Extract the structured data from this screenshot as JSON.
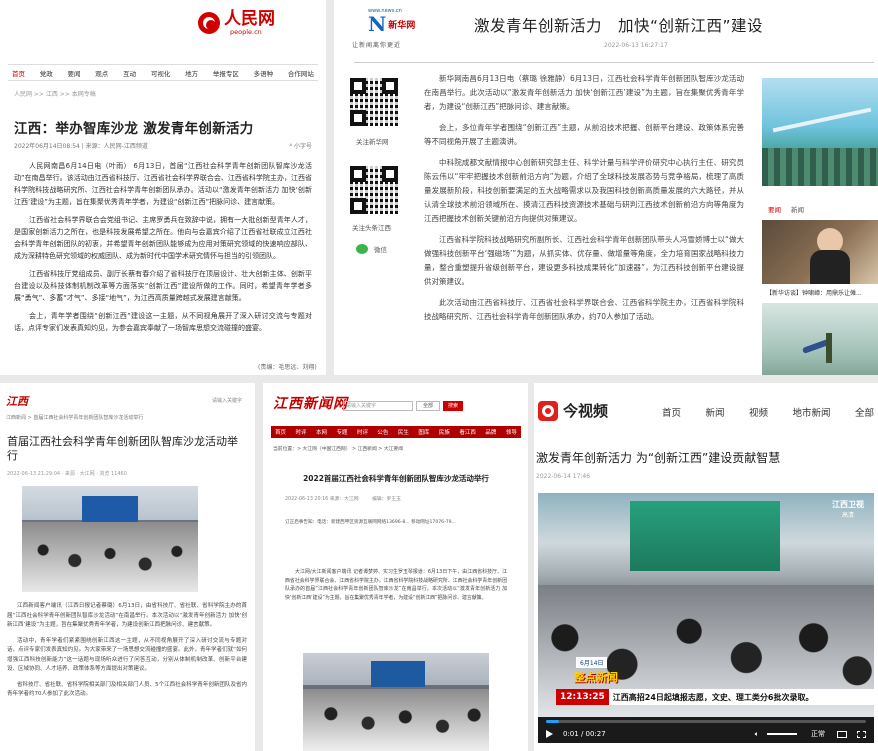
{
  "p1": {
    "logo": "人民网",
    "logo_sub": "people.cn",
    "nav": [
      "首页",
      "党政",
      "要闻",
      "观点",
      "互动",
      "可视化",
      "地方",
      "举报专区",
      "多语种",
      "合作网站"
    ],
    "breadcrumb": "人民网 >> 江西 >> 本网专稿",
    "title": "江西：举办智库沙龙 激发青年创新活力",
    "meta": "2022年06月14日08:54 | 来源：人民网-江西频道",
    "font_btn": "小字号",
    "paras": [
      "人民网南昌6月14日电（叶雨） 6月13日，首届“江西社会科学青年创新团队智库沙龙活动”在南昌举行。该活动由江西省科技厅、江西省社会科学界联合会、江西省科学院主办，江西省科学院科技战略研究所、江西社会科学青年创新团队承办。活动以“激发青年创新活力 加快‘创新江西’建设”为主题，旨在集聚优秀青年学者，为建设“创新江西”把脉问诊、建言献策。",
      "江西省社会科学界联合会党组书记、主席罗勇兵在致辞中说，拥有一大批创新型青年人才，是国家创新活力之所在，也是科技发展希望之所在。他向与会嘉宾介绍了江西省社联成立江西社会科学青年创新团队的初衷，并希望青年创新团队能够成为应用对策研究领域的快速响应部队、成为深耕特色研究领域的权威团队、成为新时代中国学术研究情怀与担当的引领团队。",
      "江西省科技厅党组成员、副厅长蔡有春介绍了省科技厅在顶层设计、壮大创新主体、创新平台建设以及科技体制机制改革等方面落实“创新江西”建设所做的工作。同时，希望青年学者多展“勇气”、多蓄“才气”、多接“地气”，为江西高质量跨越式发展建言献策。",
      "会上，青年学者围绕“创新江西”建设这一主题，从不同视角展开了深入研讨交流与专题对话，点评专家们发表真知灼见，为参会嘉宾奉献了一场智库思想交流碰撞的盛宴。"
    ],
    "editor": "(责编：毛思远、刘翔)"
  },
  "p2": {
    "logo_top": "www.news.cn",
    "logo_brand": "新华网",
    "logo_tag": "让新闻离你更近",
    "title": "激发青年创新活力　加快“创新江西”建设",
    "date": "2022-06-13 16:27:17",
    "qr1_label": "关注新华网",
    "qr2_label": "关注头条江西",
    "wechat": "微信",
    "paras": [
      "新华网南昌6月13日电（蔡璐 徐雅静）6月13日，江西社会科学青年创新团队智库沙龙活动在南昌举行。此次活动以“激发青年创新活力 加快‘创新江西’建设”为主题，旨在集聚优秀青年学者，为建设“创新江西”把脉问诊、建言献策。",
      "会上，多位青年学者围绕“创新江西”主题，从前沿技术把握、创新平台建设、政策体系完善等不同视角开展了主题演讲。",
      "中科院成都文献情报中心创新研究部主任、科学计量与科学评价研究中心执行主任、研究员陈云伟以“牢牢把握技术创新前沿方向”为题，介绍了全球科技发展态势与竞争格局，梳理了高质量发展新阶段，科技创新要满足的五大战略需求以及我国科技创新高质量发展的六大路径，并从认清全球技术前沿领域所在、摸清江西科技资源技术基础与研判江西技术创新前沿方向等角度为江西把握技术创新关键前沿方向提供对策建议。",
      "江西省科学院科技战略研究所副所长、江西社会科学青年创新团队带头人冯雪娇博士以“做大做强科技创新平台‘强磁场’”为题，从抓实体、优存量、做增量等角度，全力培育国家战略科技力量，整合重塑提升省级创新平台，建设更多科技成果转化“加速器”，为江西科技创新平台建设提供对策建议。",
      "此次活动由江西省科技厅、江西省社会科学界联合会、江西省科学院主办，江西省科学院科技战略研究所、江西社会科学青年创新团队承办，约70人参加了活动。"
    ],
    "side_tabs": [
      "要闻",
      "新闻"
    ],
    "side_caption": "【新华访谈】钟啸嶂：用鼎乐让傩..."
  },
  "p3": {
    "logo": "江西",
    "breadcrumb": "江西新闻 > 首届江西社会科学青年创新团队智库沙龙活动举行",
    "login": "请输入关键字",
    "title": "首届江西社会科学青年创新团队智库沙龙活动举行",
    "meta": "2022-06-13 21:29:04 · 来源 · 大江网 · 浏览 11460",
    "paras": [
      "江西新闻客户端讯（江西日报记者蔡璐）6月13日，由省科技厅、省社联、省科学院主办的首届“江西社会科学青年创新团队智库沙龙活动”在南昌举行。本次活动以“激发青年创新活力 加快‘创新江西’建设”为主题，旨在集聚优秀青年学者，为建设创新江西把脉问诊、建言献策。",
      "活动中，青年学者们紧紧围绕创新江西这一主题，从不同视角展开了深入研讨交流与专题对话，点评专家们发表真知灼见。为大家带来了一场思想交流碰撞的盛宴。此外，青年学者们就“如何增强江西科技创新能力”这一话题与现场听众进行了问答互动，分别从体制机制改革、创新平台建设、区域协同、人才培养、政策体系等方面提出对策建议。",
      "省科技厅、省社联、省科学院相关部门及相关部门人员、5个江西社会科学青年创新团队及省内青年学者约70人参加了此次活动。"
    ]
  },
  "p4": {
    "logo": "江西新闻网",
    "search_placeholder": "请输入关键字",
    "search_sel": "全部",
    "search_btn": "搜索",
    "nav": [
      "首页",
      "时评",
      "本网",
      "专题",
      "时评",
      "公告",
      "民生",
      "图库",
      "民族",
      "看江西",
      "品牌",
      "领导"
    ],
    "breadcrumb": "当前位置：> 大江网（中国江西网） > 江西新闻 > 大江要闻",
    "title": "2022首届江西社会科学青年创新团队智库沙龙活动举行",
    "meta": "2022-06-13 20:16  来源：大江网",
    "meta2": "编辑：罗王玉",
    "notice": "订正启事告知：电话：新建西甲区资源互联网网络13696-8... 移动网址17076-79...",
    "paras": [
      "大江网/大江新闻客户端讯 记者谭梦婷、实习生罗玉琴报道：6月13日下午，由江西省科技厅、江西省社会科学界联合会、江西省科学院主办，江西省科学院科技战略研究所、江西社会科学青年创新团队承办的首届“江西社会科学青年创新团队智库沙龙”在南昌举行。本次活动以“激发青年创新活力 加快‘创新江西’建设”为主题，旨在集聚优秀青年学者，为建设“创新江西”把脉问诊、建言献策。"
    ]
  },
  "p5": {
    "logo": "今视频",
    "nav": [
      "首页",
      "新闻",
      "视频",
      "地市新闻",
      "全部"
    ],
    "title": "激发青年创新活力 为“创新江西”建设贡献智慧",
    "date": "2022-06-14 17:46",
    "channel": "江西卫视",
    "channel_sub": "高清",
    "date_badge": "6月14日",
    "show": "整点新闻",
    "clock": "12:13:25",
    "ticker": "江西高招24日起填报志愿，文史、理工类分6批次录取。",
    "time": "0:01 / 00:27",
    "quality": "正常",
    "progress": 0.04
  }
}
